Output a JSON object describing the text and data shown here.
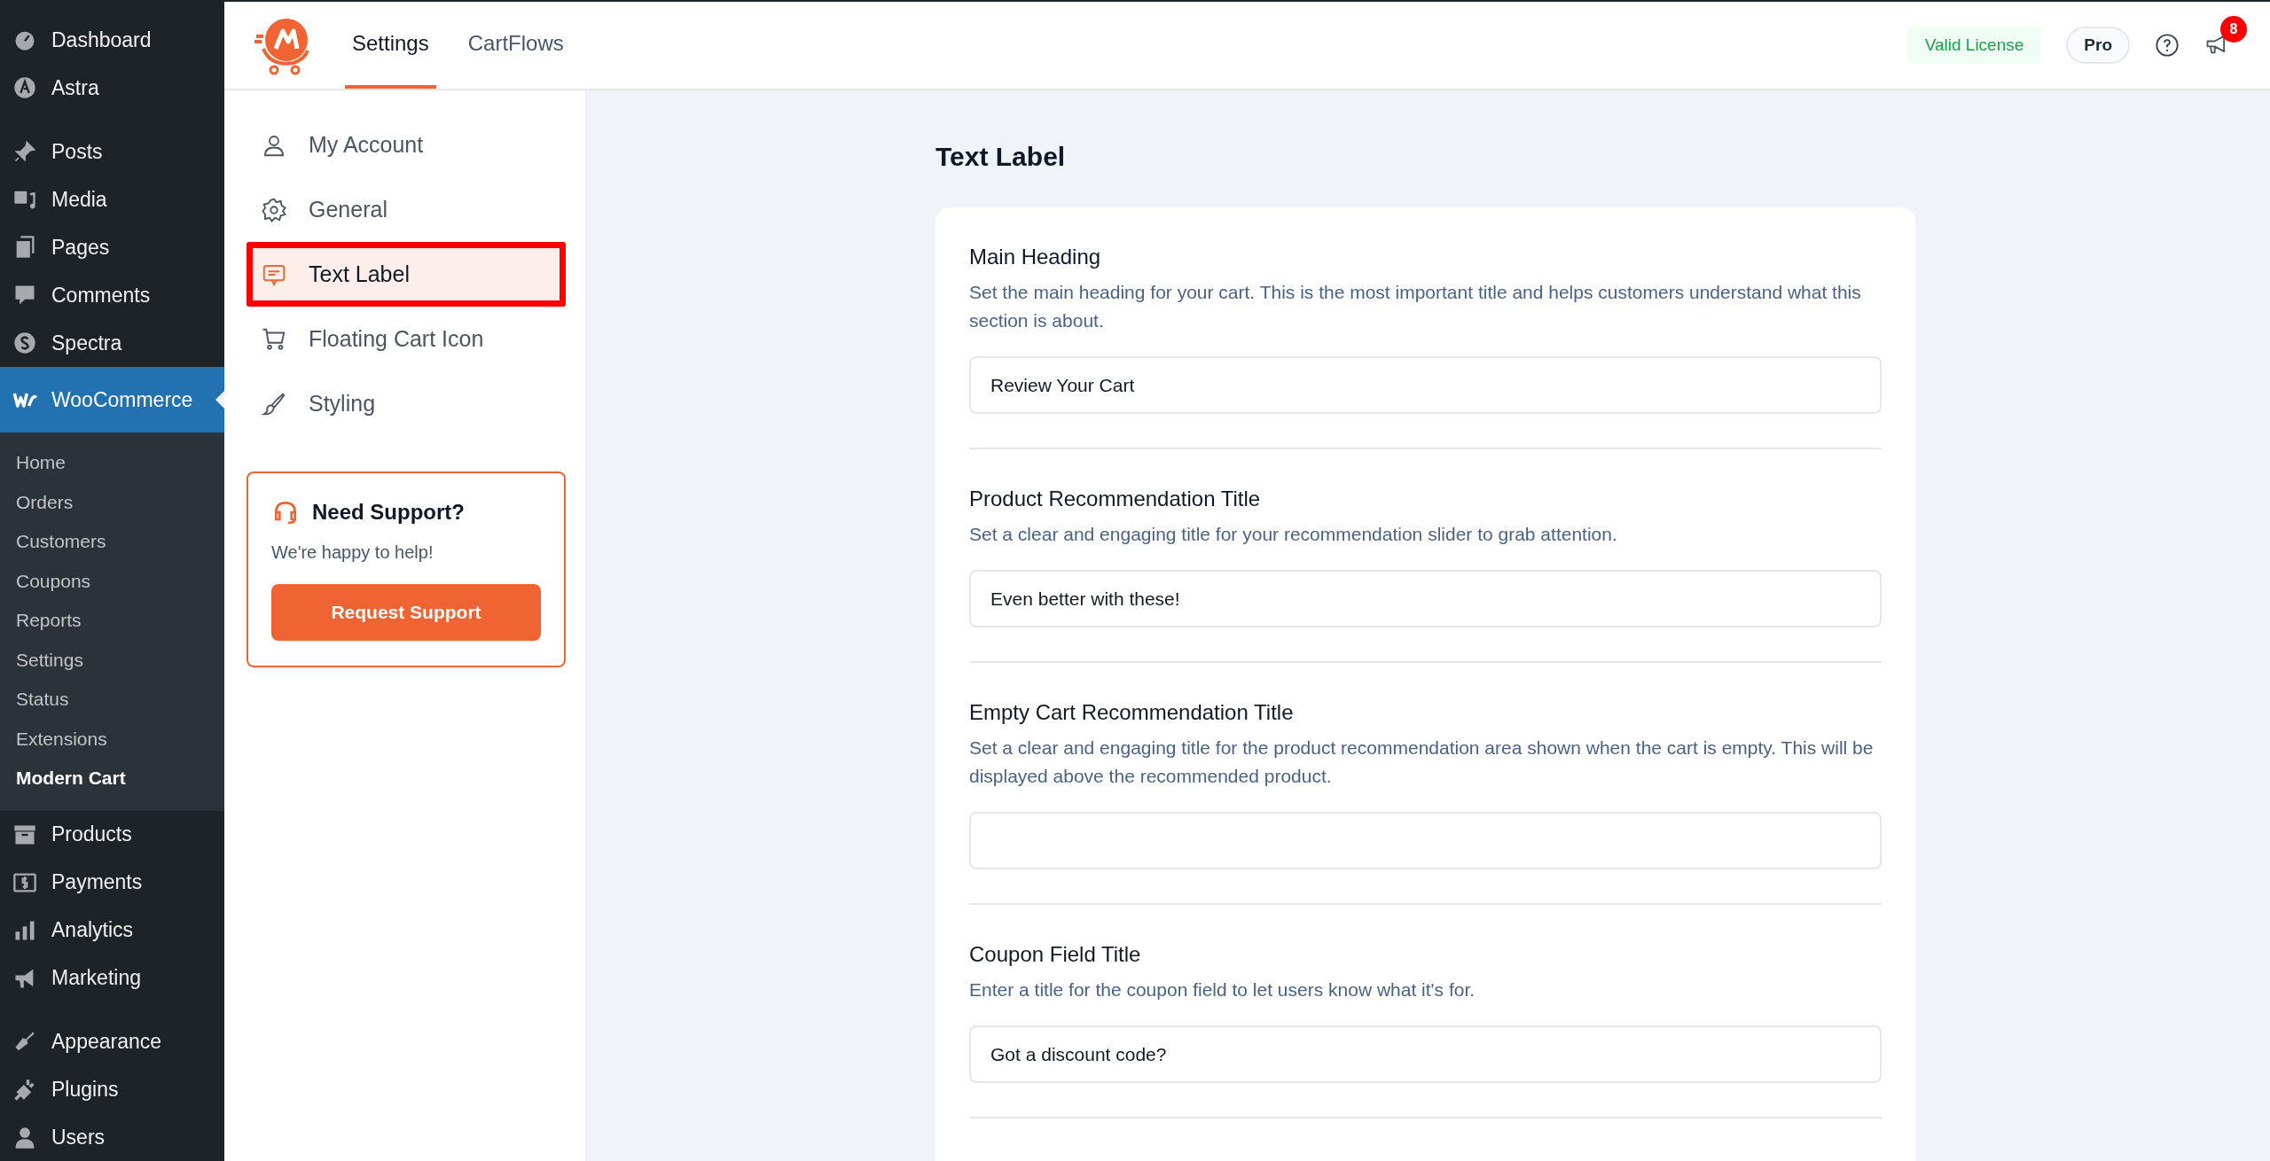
{
  "wp_menu": {
    "groups": [
      [
        {
          "label": "Dashboard",
          "selected": false
        },
        {
          "label": "Astra",
          "selected": false
        }
      ],
      [
        {
          "label": "Posts",
          "selected": false
        },
        {
          "label": "Media",
          "selected": false
        },
        {
          "label": "Pages",
          "selected": false
        },
        {
          "label": "Comments",
          "selected": false
        },
        {
          "label": "Spectra",
          "selected": false
        },
        {
          "label": "WooCommerce",
          "selected": true,
          "submenu": [
            {
              "label": "Home",
              "selected": false
            },
            {
              "label": "Orders",
              "selected": false
            },
            {
              "label": "Customers",
              "selected": false
            },
            {
              "label": "Coupons",
              "selected": false
            },
            {
              "label": "Reports",
              "selected": false
            },
            {
              "label": "Settings",
              "selected": false
            },
            {
              "label": "Status",
              "selected": false
            },
            {
              "label": "Extensions",
              "selected": false
            },
            {
              "label": "Modern Cart",
              "selected": true
            }
          ]
        },
        {
          "label": "Products",
          "selected": false
        },
        {
          "label": "Payments",
          "selected": false
        },
        {
          "label": "Analytics",
          "selected": false
        },
        {
          "label": "Marketing",
          "selected": false
        }
      ],
      [
        {
          "label": "Appearance",
          "selected": false
        },
        {
          "label": "Plugins",
          "selected": false
        },
        {
          "label": "Users",
          "selected": false
        }
      ]
    ]
  },
  "header": {
    "tabs": [
      {
        "label": "Settings",
        "selected": true
      },
      {
        "label": "CartFlows",
        "selected": false
      }
    ],
    "license": "Valid License",
    "plan": "Pro",
    "notifications": "8"
  },
  "settings_nav": {
    "items": [
      {
        "label": "My Account",
        "selected": false
      },
      {
        "label": "General",
        "selected": false
      },
      {
        "label": "Text Label",
        "selected": true
      },
      {
        "label": "Floating Cart Icon",
        "selected": false
      },
      {
        "label": "Styling",
        "selected": false
      }
    ],
    "support": {
      "title": "Need Support?",
      "text": "We're happy to help!",
      "button": "Request Support"
    }
  },
  "content": {
    "title": "Text Label",
    "fields": [
      {
        "label": "Main Heading",
        "description": "Set the main heading for your cart. This is the most important title and helps customers understand what this section is about.",
        "value": "Review Your Cart"
      },
      {
        "label": "Product Recommendation Title",
        "description": "Set a clear and engaging title for your recommendation slider to grab attention.",
        "value": "Even better with these!"
      },
      {
        "label": "Empty Cart Recommendation Title",
        "description": "Set a clear and engaging title for the product recommendation area shown when the cart is empty. This will be displayed above the recommended product."
      },
      {
        "label": "Coupon Field Title",
        "description": "Enter a title for the coupon field to let users know what it's for.",
        "value": "Got a discount code?"
      }
    ]
  }
}
